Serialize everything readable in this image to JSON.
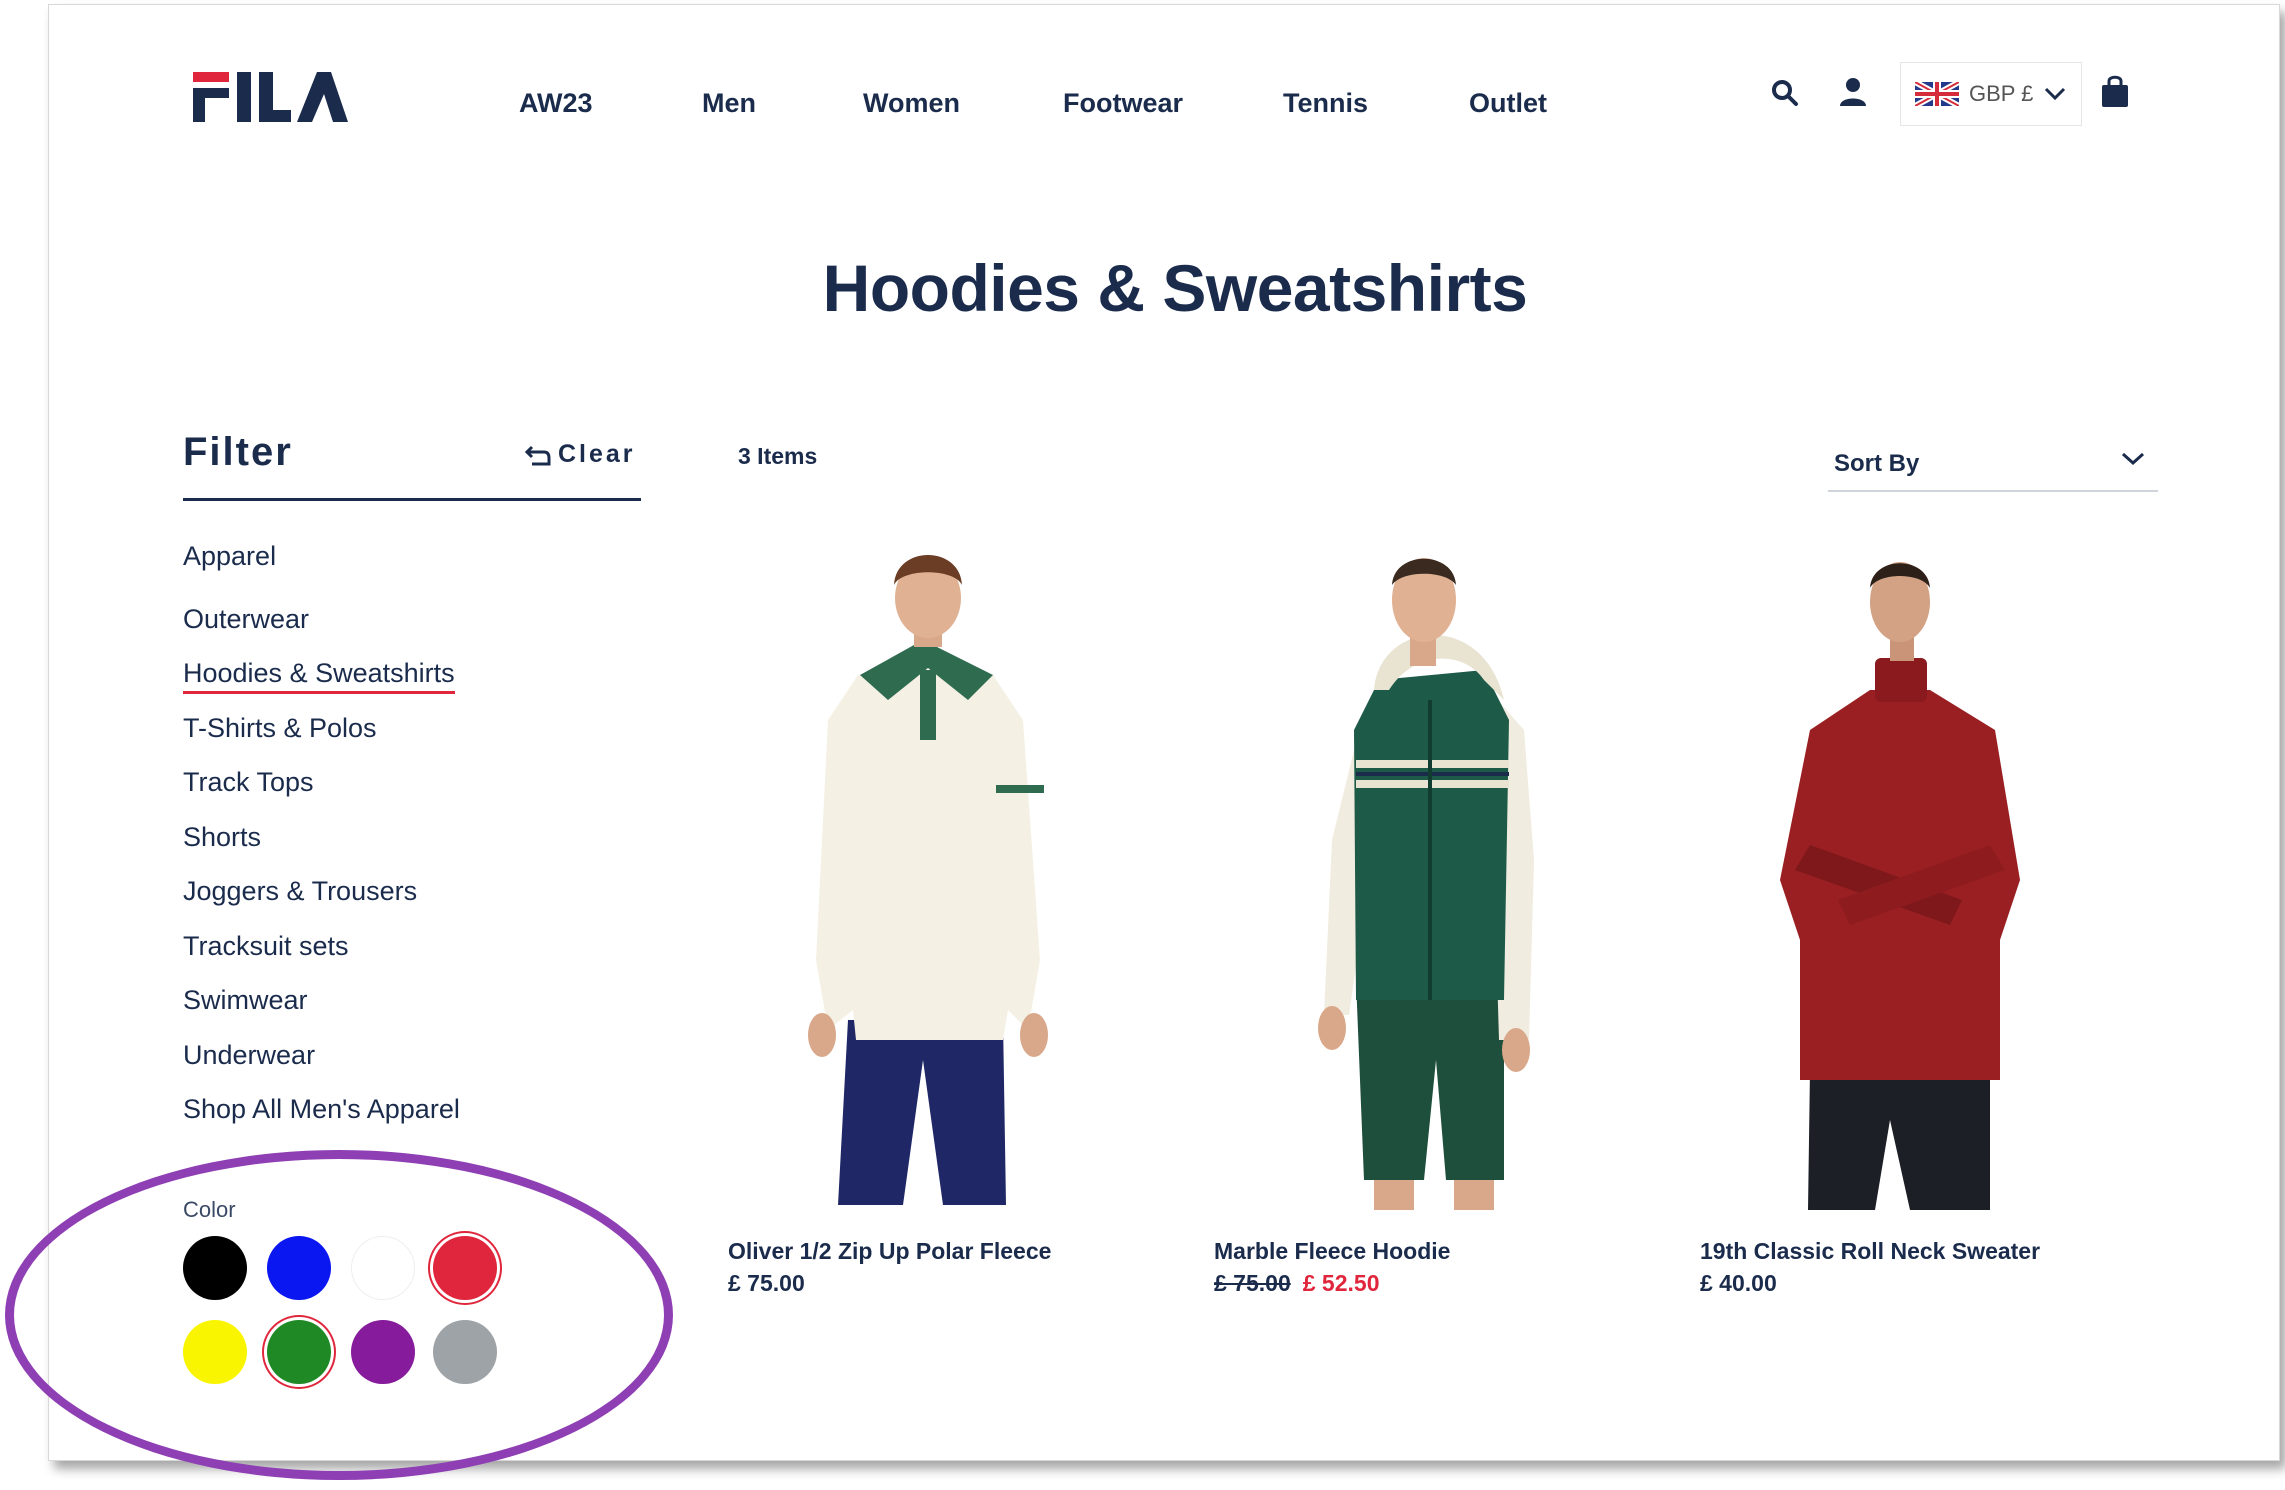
{
  "brand": {
    "logo_text": "FILA",
    "colors": {
      "navy": "#1a2b4c",
      "red": "#e0263c"
    }
  },
  "nav": {
    "items": [
      {
        "label": "AW23"
      },
      {
        "label": "Men"
      },
      {
        "label": "Women"
      },
      {
        "label": "Footwear"
      },
      {
        "label": "Tennis"
      },
      {
        "label": "Outlet"
      }
    ]
  },
  "header": {
    "icons": [
      "search-icon",
      "account-icon",
      "uk-flag-icon",
      "chevron-down-icon",
      "bag-icon"
    ],
    "currency": "GBP £"
  },
  "page": {
    "title": "Hoodies & Sweatshirts"
  },
  "filter": {
    "title": "Filter",
    "clear_label": "Clear",
    "section": "Apparel",
    "categories": [
      {
        "label": "Outerwear"
      },
      {
        "label": "Hoodies & Sweatshirts",
        "active": true
      },
      {
        "label": "T-Shirts & Polos"
      },
      {
        "label": "Track Tops"
      },
      {
        "label": "Shorts"
      },
      {
        "label": "Joggers & Trousers"
      },
      {
        "label": "Tracksuit sets"
      },
      {
        "label": "Swimwear"
      },
      {
        "label": "Underwear"
      },
      {
        "label": "Shop All Men's Apparel"
      }
    ],
    "color_label": "Color",
    "colors": [
      {
        "name": "black",
        "hex": "#000000"
      },
      {
        "name": "blue",
        "hex": "#0b17f0"
      },
      {
        "name": "white",
        "hex": "#ffffff"
      },
      {
        "name": "red",
        "hex": "#e0263c",
        "selected": true
      },
      {
        "name": "yellow",
        "hex": "#f9f500"
      },
      {
        "name": "green",
        "hex": "#1f8a25",
        "selected": true
      },
      {
        "name": "purple",
        "hex": "#861c9c"
      },
      {
        "name": "grey",
        "hex": "#9ea3a7"
      }
    ]
  },
  "results": {
    "count_label": "3 Items",
    "sort_label": "Sort By"
  },
  "products": [
    {
      "name": "Oliver 1/2 Zip Up Polar Fleece",
      "price": "£ 75.00"
    },
    {
      "name": "Marble Fleece Hoodie",
      "old_price": "£ 75.00",
      "sale_price": "£ 52.50"
    },
    {
      "name": "19th Classic Roll Neck Sweater",
      "price": "£ 40.00"
    }
  ]
}
